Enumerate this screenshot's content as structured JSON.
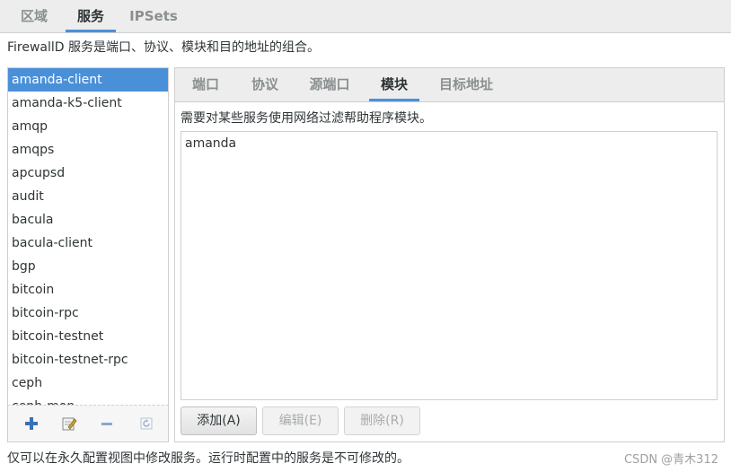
{
  "top_tabs": [
    {
      "label": "区域",
      "active": false
    },
    {
      "label": "服务",
      "active": true
    },
    {
      "label": "IPSets",
      "active": false
    }
  ],
  "description": "FirewallD 服务是端口、协议、模块和目的地址的组合。",
  "services": [
    "amanda-client",
    "amanda-k5-client",
    "amqp",
    "amqps",
    "apcupsd",
    "audit",
    "bacula",
    "bacula-client",
    "bgp",
    "bitcoin",
    "bitcoin-rpc",
    "bitcoin-testnet",
    "bitcoin-testnet-rpc",
    "ceph",
    "ceph-mon"
  ],
  "selected_service": "amanda-client",
  "toolbar_icons": [
    "plus-icon",
    "edit-icon",
    "minus-icon",
    "reload-icon"
  ],
  "sub_tabs": [
    {
      "label": "端口",
      "active": false
    },
    {
      "label": "协议",
      "active": false
    },
    {
      "label": "源端口",
      "active": false
    },
    {
      "label": "模块",
      "active": true
    },
    {
      "label": "目标地址",
      "active": false
    }
  ],
  "module_description": "需要对某些服务使用网络过滤帮助程序模块。",
  "modules": [
    "amanda"
  ],
  "buttons": {
    "add": "添加(A)",
    "edit": "编辑(E)",
    "remove": "删除(R)"
  },
  "footer": "仅可以在永久配置视图中修改服务。运行时配置中的服务是不可修改的。",
  "watermark": "CSDN @青木312",
  "colors": {
    "accent": "#4a90d9",
    "plus_icon": "#3b6fb6",
    "edit_icon": "#c9a13a"
  }
}
